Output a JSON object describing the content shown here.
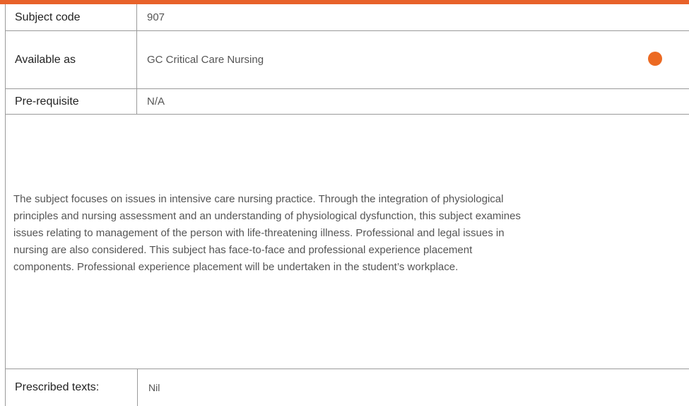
{
  "subject_code": {
    "label": "Subject code",
    "value": "907"
  },
  "available_as": {
    "label": "Available as",
    "value": "GC Critical Care Nursing",
    "indicator_color": "#ec6a23"
  },
  "prerequisite": {
    "label": "Pre-requisite",
    "value": "N/A"
  },
  "description": {
    "lines": [
      "The subject focuses on issues in intensive care nursing practice. Through the integration of physiological",
      "principles and nursing assessment and an understanding of physiological dysfunction, this subject examines",
      "issues relating to management of the person with life-threatening illness. Professional and legal issues in",
      "nursing are also considered. This subject has face-to-face and professional experience placement",
      "components. Professional experience placement will be undertaken in the student’s workplace."
    ]
  },
  "prescribed_texts": {
    "label": "Prescribed texts:",
    "value": "Nil"
  },
  "colors": {
    "accent": "#e8622a",
    "border": "#9a9a9a"
  }
}
